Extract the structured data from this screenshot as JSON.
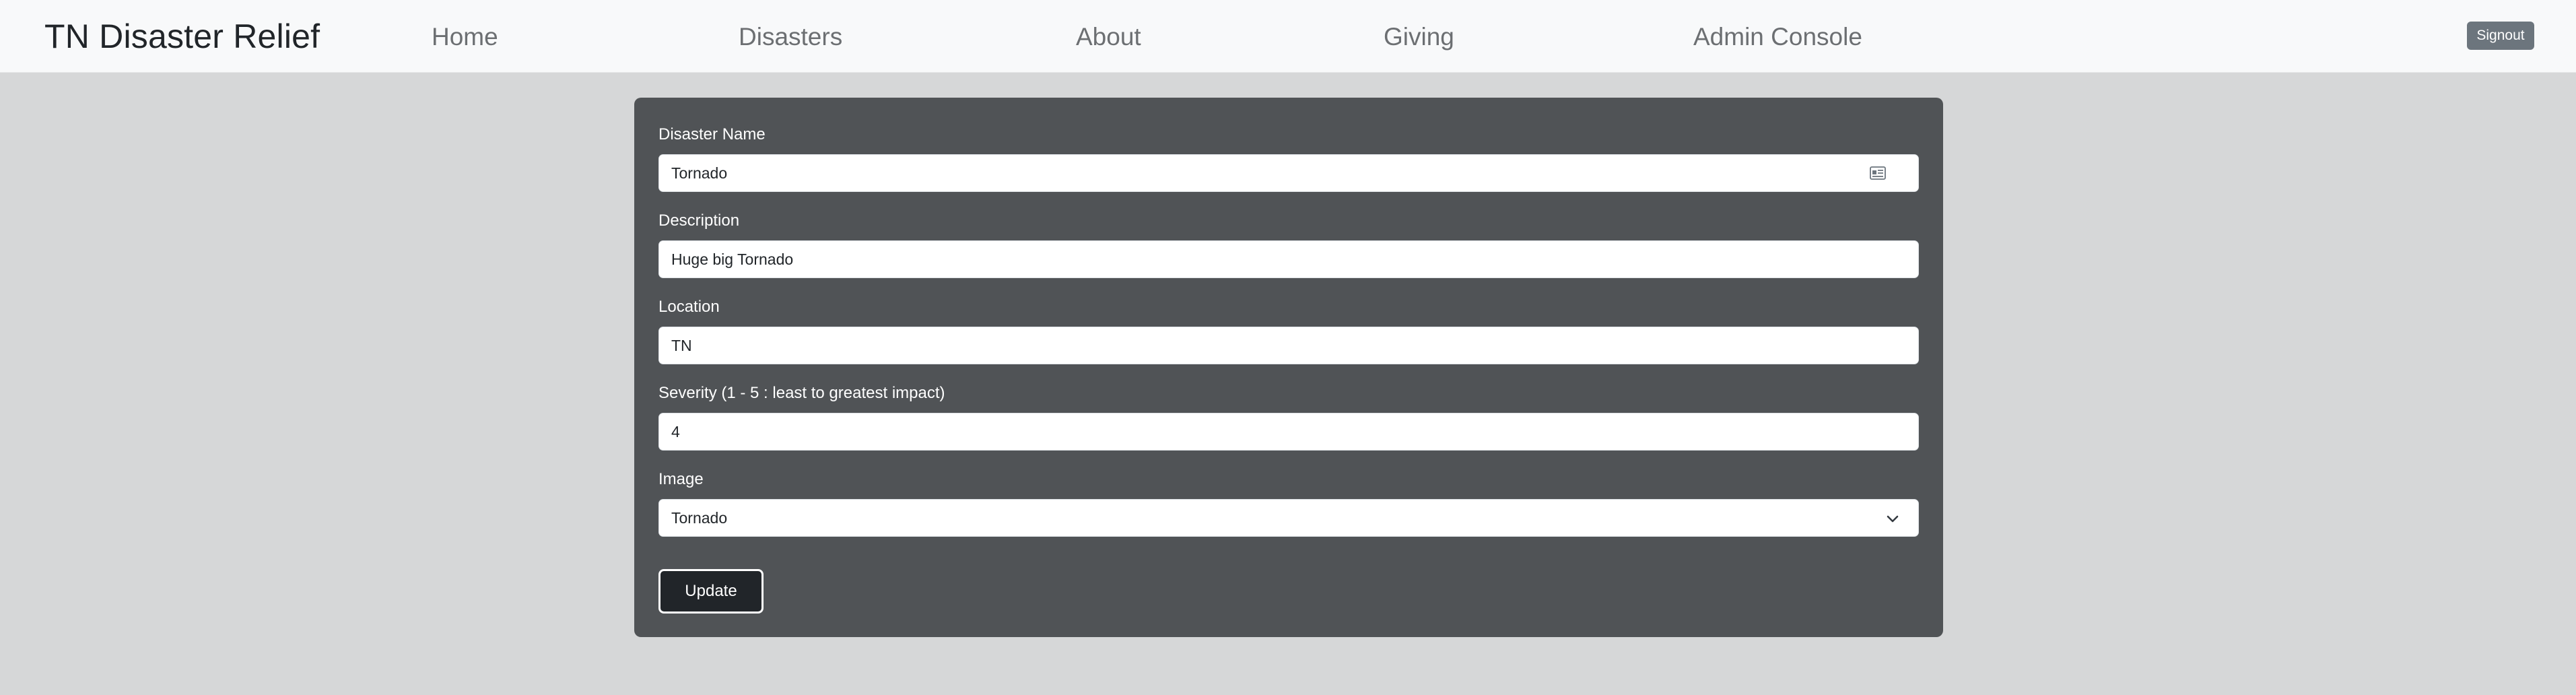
{
  "navbar": {
    "brand": "TN Disaster Relief",
    "links": [
      {
        "label": "Home"
      },
      {
        "label": "Disasters"
      },
      {
        "label": "About"
      },
      {
        "label": "Giving"
      },
      {
        "label": "Admin Console"
      }
    ],
    "signout_label": "Signout"
  },
  "form": {
    "fields": [
      {
        "label": "Disaster Name",
        "value": "Tornado",
        "icon": "contact-card-icon"
      },
      {
        "label": "Description",
        "value": "Huge big Tornado"
      },
      {
        "label": "Location",
        "value": "TN"
      },
      {
        "label": "Severity (1 - 5 : least to greatest impact)",
        "value": "4"
      },
      {
        "label": "Image",
        "value": "Tornado",
        "icon": "chevron-down-icon"
      }
    ],
    "submit_label": "Update"
  },
  "colors": {
    "page_bg": "#d6d7d8",
    "navbar_bg": "#f8f9fa",
    "card_bg": "#505356",
    "button_dark": "#212529",
    "signout_bg": "#6c757d"
  }
}
